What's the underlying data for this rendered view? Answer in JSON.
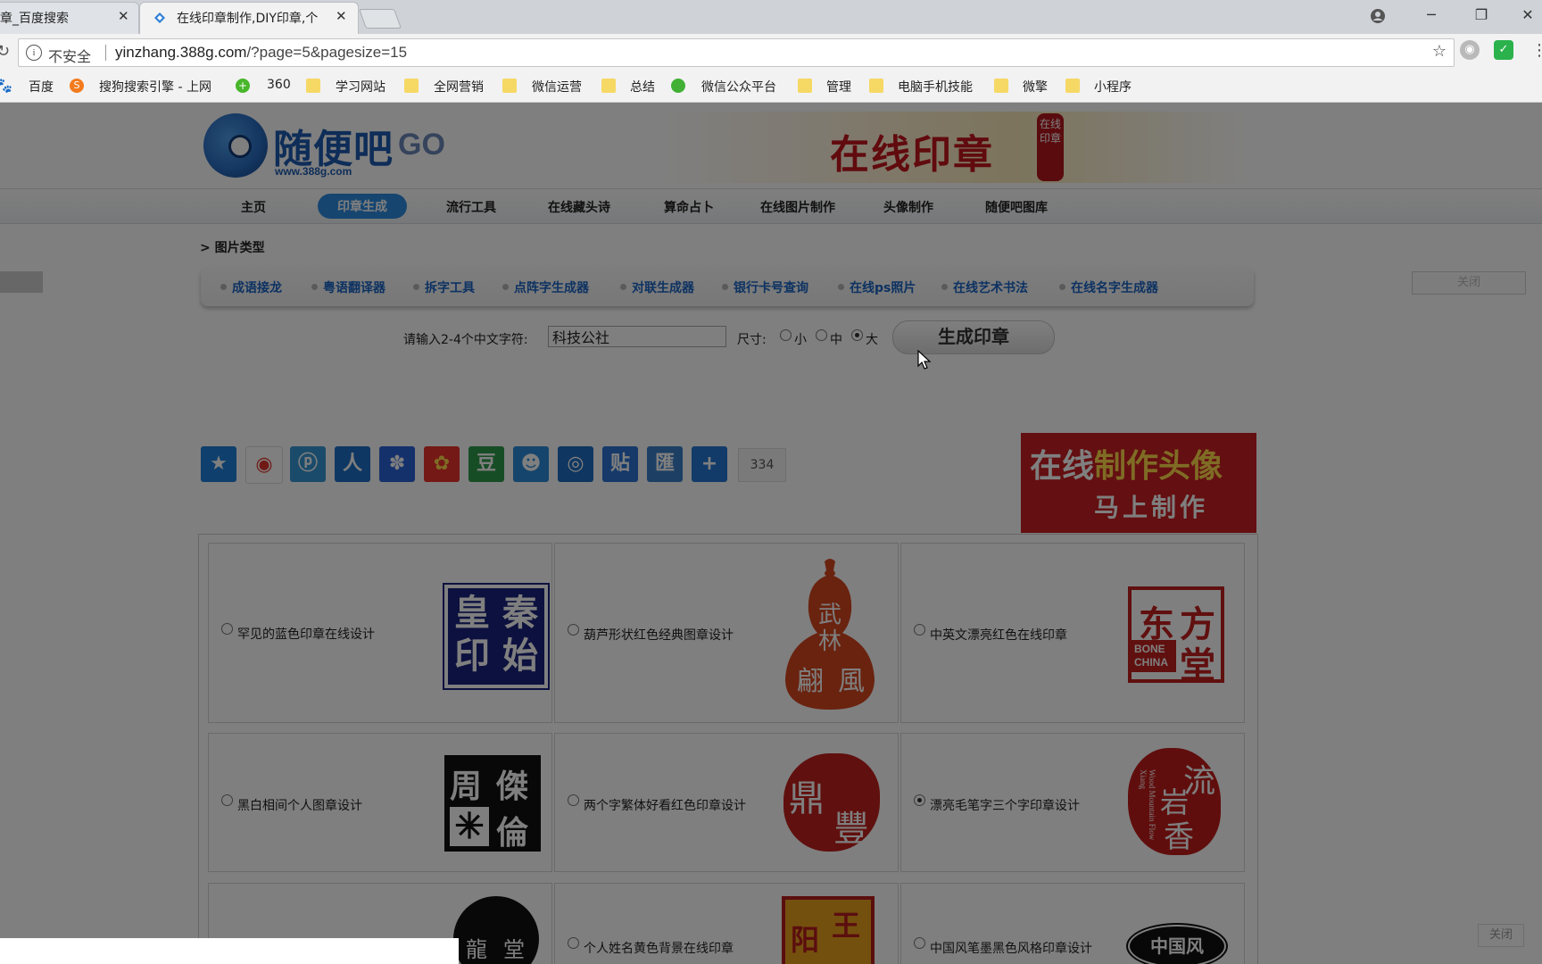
{
  "browser": {
    "tabs": [
      {
        "title": "章_百度搜索",
        "active": false
      },
      {
        "title": "在线印章制作,DIY印章,个",
        "active": true
      }
    ],
    "address": {
      "security_label": "不安全",
      "url_host": "yinzhang.388g.com",
      "url_path": "/?page=5&pagesize=15"
    },
    "bookmarks": [
      {
        "label": "百度",
        "icon": "baidu-paw-icon"
      },
      {
        "label": "搜狗搜索引擎 - 上网",
        "icon": "sogou-icon"
      },
      {
        "label": "360",
        "icon": "360-icon"
      },
      {
        "label": "学习网站",
        "icon": "folder-icon"
      },
      {
        "label": "全网营销",
        "icon": "folder-icon"
      },
      {
        "label": "微信运营",
        "icon": "folder-icon"
      },
      {
        "label": "总结",
        "icon": "folder-icon"
      },
      {
        "label": "微信公众平台",
        "icon": "wechat-icon"
      },
      {
        "label": "管理",
        "icon": "folder-icon"
      },
      {
        "label": "电脑手机技能",
        "icon": "folder-icon"
      },
      {
        "label": "微擎",
        "icon": "folder-icon"
      },
      {
        "label": "小程序",
        "icon": "folder-icon"
      }
    ]
  },
  "site": {
    "logo_text": "随便吧",
    "logo_go": "GO",
    "logo_url": "www.388g.com",
    "banner_text": "在线印章",
    "banner_seal": "在线印章",
    "nav": [
      "主页",
      "印章生成",
      "流行工具",
      "在线藏头诗",
      "算命占卜",
      "在线图片制作",
      "头像制作",
      "随便吧图库"
    ],
    "nav_active": "印章生成",
    "breadcrumb": "> 图片类型",
    "close_label": "关闭",
    "tools": [
      "成语接龙",
      "粤语翻译器",
      "拆字工具",
      "点阵字生成器",
      "对联生成器",
      "银行卡号查询",
      "在线ps照片",
      "在线艺术书法",
      "在线名字生成器"
    ],
    "form": {
      "prompt": "请输入2-4个中文字符:",
      "input_value": "科技公社",
      "size_label": "尺寸:",
      "sizes": [
        "小",
        "中",
        "大"
      ],
      "size_selected": "大",
      "generate_label": "生成印章"
    },
    "share_count": "334",
    "share_icons": [
      "qzone-star-icon",
      "weibo-icon",
      "tencent-weibo-icon",
      "renren-icon",
      "baidu-paw-icon",
      "kaixin-icon",
      "douban-icon",
      "friends-icon",
      "tencent-icon",
      "tieba-icon",
      "digest-icon",
      "more-plus-icon"
    ],
    "ad": {
      "line1_a": "在线",
      "line1_b": "制作头像",
      "line2": "马上制作"
    },
    "cards": [
      {
        "title": "罕见的蓝色印章在线设计",
        "seal_chars": [
          "皇",
          "秦",
          "印",
          "始"
        ],
        "selected": false
      },
      {
        "title": "葫芦形状红色经典图章设计",
        "seal_chars": [
          "武",
          "林",
          "翩",
          "風"
        ],
        "selected": false
      },
      {
        "title": "中英文漂亮红色在线印章",
        "seal_chars": [
          "东",
          "方",
          "堂"
        ],
        "seal_english": [
          "BONE",
          "CHINA"
        ],
        "selected": false
      },
      {
        "title": "黑白相间个人图章设计",
        "seal_chars": [
          "周",
          "傑",
          "倫"
        ],
        "selected": false
      },
      {
        "title": "两个字繁体好看红色印章设计",
        "seal_chars": [
          "鼎",
          "豐"
        ],
        "selected": false
      },
      {
        "title": "漂亮毛笔字三个字印章设计",
        "seal_chars": [
          "流",
          "岩",
          "香"
        ],
        "seal_english": "Wood Mountain Flow Xiang",
        "selected": true
      },
      {
        "title": "",
        "seal_chars": [
          "龍",
          "堂"
        ],
        "selected": false
      },
      {
        "title": "个人姓名黄色背景在线印章",
        "seal_chars": [
          "王",
          "阳"
        ],
        "selected": false
      },
      {
        "title": "中国风笔墨黑色风格印章设计",
        "seal_chars": [
          "中国风"
        ],
        "selected": false
      }
    ]
  }
}
